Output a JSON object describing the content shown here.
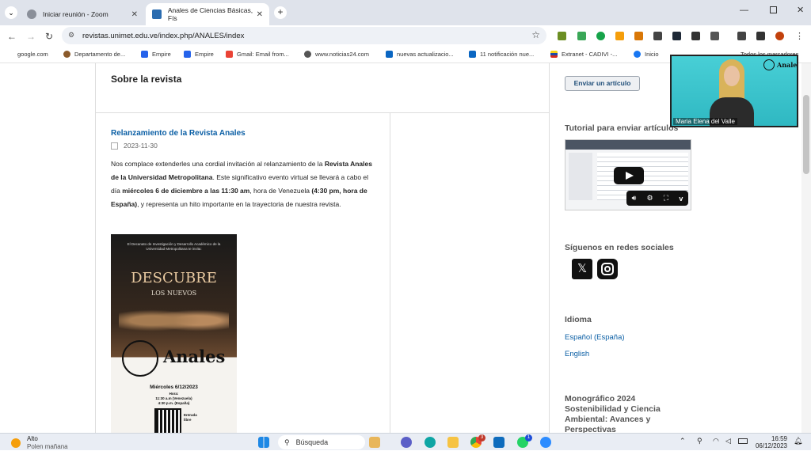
{
  "browser": {
    "tabs": [
      {
        "title": "Iniciar reunión - Zoom",
        "active": false,
        "icon": "zoom-icon"
      },
      {
        "title": "Anales de Ciencias Básicas, Fís",
        "active": true,
        "icon": "journal-icon"
      }
    ],
    "url": "revistas.unimet.edu.ve/index.php/ANALES/index",
    "bookmarks": [
      "google.com",
      "Departamento de...",
      "Empire",
      "Empire",
      "Gmail: Email from...",
      "www.noticias24.com",
      "nuevas actualizacio...",
      "11 notificación nue...",
      "Extranet - CADIVI -...",
      "Inicio",
      "Todos los marcadores"
    ]
  },
  "page": {
    "section_title": "Sobre la revista",
    "article": {
      "title": "Relanzamiento de la Revista Anales",
      "date": "2023-11-30",
      "p1": "Nos complace extenderles una cordial invitación al relanzamiento de la",
      "p1_bold": "Revista Anales de la Universidad Metropolitana",
      "p2": ". Este significativo evento virtual se llevará a cabo el día",
      "p2_bold": "miércoles 6 de diciembre a las 11:30 am",
      "p3": ", hora de Venezuela",
      "p3_bold": "(4:30 pm, hora de España)",
      "p4": ", y representa un hito importante en la trayectoria de nuestra revista."
    },
    "poster": {
      "header": "El Decanato de Investigación y Desarrollo Académico de la Universidad Metropolitana te invita:",
      "headline": "DESCUBRE",
      "subheadline": "LOS NUEVOS",
      "brand": "Anales",
      "date_line": "Miércoles 6/12/2023",
      "hora_label": "Hora:",
      "hora_ve": "11:30 a.m (Venezuela)",
      "hora_es": "4:30 p.m. (España)",
      "entry": "Entrada libre"
    }
  },
  "sidebar": {
    "submit_button": "Enviar un artículo",
    "tutorial_heading": "Tutorial para enviar artículos",
    "social_heading": "Síguenos en redes sociales",
    "language_heading": "Idioma",
    "languages": [
      "Español (España)",
      "English"
    ],
    "monografico_heading": "Monográfico 2024 Sostenibilidad y Ciencia Ambiental: Avances y Perspectivas"
  },
  "video_overlay": {
    "participant": "Maria Elena del Valle",
    "logo_text": "Anales"
  },
  "taskbar": {
    "weather_label": "Alto",
    "weather_sub": "Polen mañana",
    "search_placeholder": "Búsqueda",
    "time": "16:59",
    "date": "06/12/2023",
    "badge_chrome": "3",
    "badge_whatsapp": "1"
  }
}
